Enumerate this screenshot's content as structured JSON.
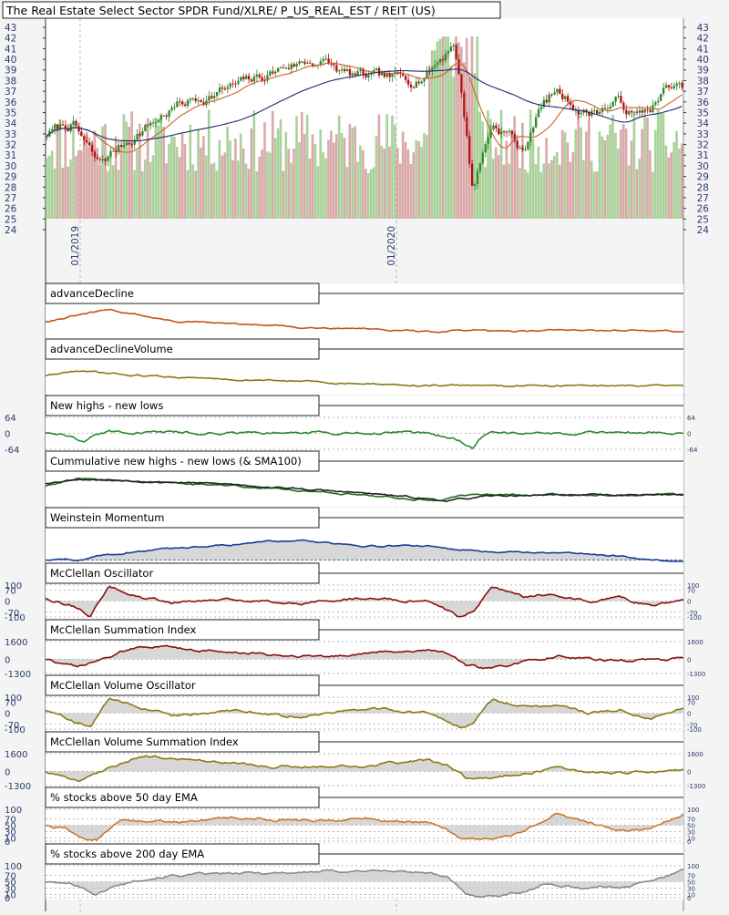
{
  "page": {
    "title": "The Real Estate Select Sector SPDR Fund/XLRE/ P_US_REAL_EST / REIT (US)",
    "x_axis_labels": [
      "01/2019",
      "01/2020"
    ]
  },
  "chart_data": [
    {
      "type": "candlestick",
      "title": "The Real Estate Select Sector SPDR Fund/XLRE/ P_US_REAL_EST / REIT (US)",
      "ylim": [
        24,
        43
      ],
      "y_ticks": [
        43,
        42,
        41,
        40,
        39,
        38,
        37,
        36,
        35,
        34,
        33,
        32,
        31,
        30,
        29,
        28,
        27,
        26,
        25,
        24
      ],
      "x_tick_labels": [
        "01/2019",
        "01/2020"
      ],
      "overlays": [
        "moving-average-short",
        "moving-average-long",
        "volume-bars"
      ],
      "colors": {
        "up": "#2a8a2a",
        "down": "#b01010",
        "ma_short": "#c8622b",
        "ma_long": "#1e2a6e",
        "volume_up": "#9cc98a",
        "volume_down": "#d49a9a"
      },
      "close_profile": {
        "t": [
          0,
          0.04,
          0.08,
          0.15,
          0.2,
          0.27,
          0.33,
          0.38,
          0.43,
          0.47,
          0.52,
          0.57,
          0.6,
          0.625,
          0.64,
          0.655,
          0.67,
          0.7,
          0.73,
          0.75,
          0.77,
          0.8,
          0.85,
          0.9,
          0.93,
          0.96,
          0.98,
          1.0
        ],
        "v": [
          33,
          34,
          30,
          33.5,
          35.5,
          37,
          38,
          39.5,
          40,
          38.5,
          38,
          38,
          39,
          40.5,
          42,
          36,
          28,
          34,
          33,
          31,
          35,
          37,
          35,
          36,
          34.5,
          36,
          37.5,
          37
        ]
      }
    },
    {
      "type": "line",
      "title": "advanceDecline",
      "series": [
        {
          "color": "#c8501e",
          "profile": {
            "t": [
              0,
              0.05,
              0.1,
              0.2,
              0.3,
              0.4,
              0.5,
              0.6,
              0.62,
              0.65,
              0.7,
              0.8,
              0.9,
              1.0
            ],
            "v": [
              0.5,
              0.7,
              0.9,
              0.5,
              0.4,
              0.3,
              0.25,
              0.15,
              0.1,
              0.2,
              0.15,
              0.2,
              0.2,
              0.15
            ]
          }
        }
      ]
    },
    {
      "type": "line",
      "title": "advanceDeclineVolume",
      "series": [
        {
          "color": "#8a7a14",
          "profile": {
            "t": [
              0,
              0.05,
              0.1,
              0.2,
              0.3,
              0.4,
              0.5,
              0.6,
              0.7,
              0.8,
              0.9,
              1.0
            ],
            "v": [
              0.55,
              0.7,
              0.6,
              0.5,
              0.4,
              0.35,
              0.25,
              0.2,
              0.2,
              0.2,
              0.2,
              0.18
            ]
          }
        }
      ]
    },
    {
      "type": "line",
      "title": "New highs - new lows",
      "y_ticks": [
        64,
        0,
        -64
      ],
      "ylim": [
        -64,
        64
      ],
      "series": [
        {
          "color": "#2a8a2a",
          "profile": {
            "t": [
              0,
              0.04,
              0.06,
              0.08,
              0.1,
              0.2,
              0.3,
              0.4,
              0.5,
              0.6,
              0.62,
              0.65,
              0.67,
              0.68,
              0.7,
              0.8,
              0.9,
              1.0
            ],
            "v": [
              5,
              -10,
              -40,
              -5,
              5,
              3,
              4,
              2,
              3,
              2,
              -10,
              -30,
              -64,
              -20,
              2,
              1,
              2,
              1
            ]
          }
        }
      ]
    },
    {
      "type": "line",
      "title": "Cummulative new highs - new lows (& SMA100)",
      "series": [
        {
          "color": "#1f6b1f",
          "profile": {
            "t": [
              0,
              0.05,
              0.1,
              0.3,
              0.5,
              0.62,
              0.65,
              0.7,
              0.8,
              1.0
            ],
            "v": [
              0.6,
              0.85,
              0.8,
              0.6,
              0.3,
              0.1,
              0.3,
              0.3,
              0.3,
              0.3
            ]
          }
        },
        {
          "color": "#222222",
          "profile": {
            "t": [
              0,
              0.05,
              0.1,
              0.3,
              0.5,
              0.63,
              0.7,
              0.8,
              1.0
            ],
            "v": [
              0.7,
              0.85,
              0.82,
              0.65,
              0.35,
              0.1,
              0.25,
              0.3,
              0.3
            ]
          }
        }
      ]
    },
    {
      "type": "area",
      "title": "Weinstein Momentum",
      "series": [
        {
          "color": "#1e3c96",
          "profile": {
            "t": [
              0,
              0.05,
              0.1,
              0.2,
              0.3,
              0.4,
              0.45,
              0.5,
              0.6,
              0.65,
              0.7,
              0.8,
              0.9,
              0.95,
              1.0
            ],
            "v": [
              0.0,
              0.0,
              0.2,
              0.4,
              0.55,
              0.7,
              0.6,
              0.45,
              0.5,
              0.35,
              0.3,
              0.25,
              0.15,
              0.0,
              -0.1
            ]
          }
        }
      ]
    },
    {
      "type": "area",
      "title": "McClellan Oscillator",
      "y_ticks": [
        100,
        70,
        0,
        -70,
        -100
      ],
      "ylim": [
        -100,
        100
      ],
      "series": [
        {
          "color": "#8a0f0f",
          "profile": {
            "t": [
              0,
              0.05,
              0.07,
              0.1,
              0.15,
              0.2,
              0.3,
              0.4,
              0.5,
              0.6,
              0.65,
              0.67,
              0.7,
              0.75,
              0.8,
              0.85,
              0.9,
              0.95,
              1.0
            ],
            "v": [
              20,
              -40,
              -90,
              90,
              20,
              -10,
              10,
              -20,
              20,
              0,
              -100,
              -60,
              90,
              30,
              40,
              0,
              20,
              -30,
              20
            ]
          }
        }
      ]
    },
    {
      "type": "area",
      "title": "McClellan Summation Index",
      "y_ticks": [
        1600,
        0,
        -1300
      ],
      "ylim": [
        -1300,
        1600
      ],
      "series": [
        {
          "color": "#8a0f0f",
          "profile": {
            "t": [
              0,
              0.05,
              0.1,
              0.15,
              0.25,
              0.35,
              0.45,
              0.6,
              0.63,
              0.66,
              0.7,
              0.8,
              0.9,
              1.0
            ],
            "v": [
              0,
              -800,
              200,
              1300,
              800,
              400,
              300,
              900,
              600,
              -700,
              -900,
              300,
              -200,
              100
            ]
          }
        }
      ]
    },
    {
      "type": "area",
      "title": "McClellan Volume Oscillator",
      "y_ticks": [
        100,
        70,
        0,
        -70,
        -100
      ],
      "ylim": [
        -100,
        100
      ],
      "series": [
        {
          "color": "#8a7a14",
          "profile": {
            "t": [
              0,
              0.05,
              0.07,
              0.1,
              0.15,
              0.2,
              0.3,
              0.4,
              0.5,
              0.6,
              0.65,
              0.67,
              0.7,
              0.75,
              0.8,
              0.85,
              0.9,
              0.95,
              1.0
            ],
            "v": [
              20,
              -60,
              -90,
              90,
              30,
              -20,
              20,
              -30,
              30,
              0,
              -90,
              -70,
              80,
              40,
              50,
              0,
              30,
              -40,
              30
            ]
          }
        }
      ]
    },
    {
      "type": "area",
      "title": "McClellan Volume Summation Index",
      "y_ticks": [
        1600,
        0,
        -1300
      ],
      "ylim": [
        -1300,
        1600
      ],
      "series": [
        {
          "color": "#8a7a14",
          "profile": {
            "t": [
              0,
              0.05,
              0.1,
              0.15,
              0.25,
              0.35,
              0.45,
              0.55,
              0.6,
              0.63,
              0.66,
              0.7,
              0.8,
              0.9,
              1.0
            ],
            "v": [
              0,
              -900,
              300,
              1400,
              900,
              500,
              300,
              800,
              1100,
              600,
              -700,
              -600,
              200,
              -200,
              100
            ]
          }
        }
      ]
    },
    {
      "type": "area",
      "title": "% stocks above 50 day EMA",
      "y_ticks": [
        100,
        70,
        50,
        30,
        10,
        0
      ],
      "ylim": [
        0,
        100
      ],
      "series": [
        {
          "color": "#c87a2e",
          "profile": {
            "t": [
              0,
              0.03,
              0.06,
              0.08,
              0.12,
              0.2,
              0.3,
              0.4,
              0.5,
              0.6,
              0.63,
              0.65,
              0.7,
              0.75,
              0.8,
              0.85,
              0.9,
              0.95,
              1.0
            ],
            "v": [
              50,
              40,
              10,
              5,
              70,
              60,
              75,
              65,
              70,
              60,
              40,
              10,
              5,
              30,
              90,
              60,
              30,
              40,
              85
            ]
          }
        }
      ]
    },
    {
      "type": "area",
      "title": "% stocks above 200 day EMA",
      "y_ticks": [
        100,
        70,
        50,
        30,
        10,
        0
      ],
      "ylim": [
        0,
        100
      ],
      "series": [
        {
          "color": "#8a8a8a",
          "profile": {
            "t": [
              0,
              0.05,
              0.08,
              0.1,
              0.15,
              0.2,
              0.3,
              0.4,
              0.5,
              0.6,
              0.63,
              0.66,
              0.7,
              0.75,
              0.78,
              0.8,
              0.85,
              0.9,
              0.95,
              1.0
            ],
            "v": [
              50,
              40,
              10,
              30,
              60,
              70,
              75,
              80,
              85,
              80,
              60,
              10,
              5,
              20,
              40,
              40,
              30,
              35,
              50,
              90
            ]
          }
        }
      ]
    }
  ]
}
